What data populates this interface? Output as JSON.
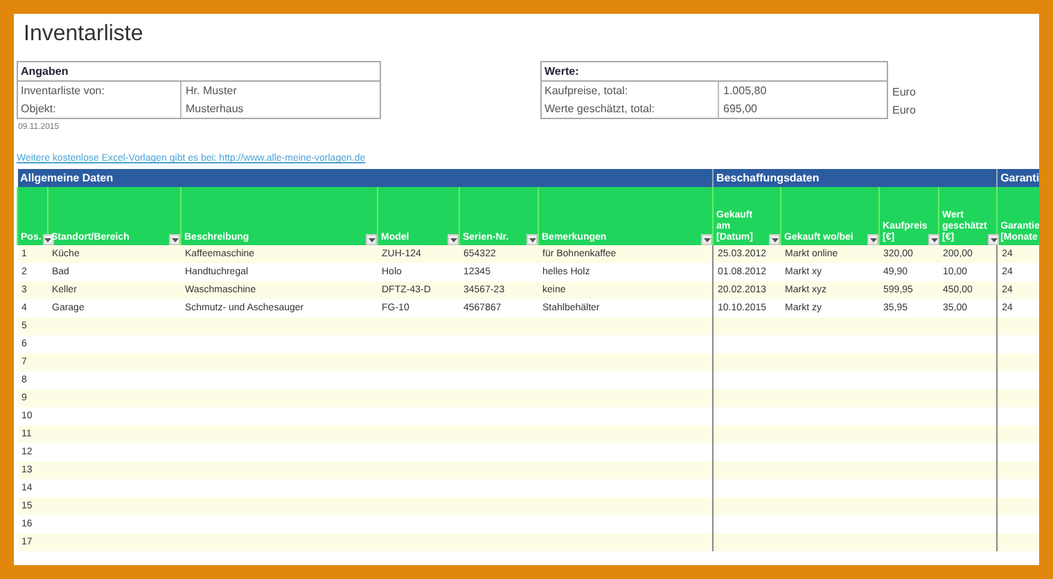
{
  "title": "Inventarliste",
  "angaben": {
    "heading": "Angaben",
    "rows": [
      {
        "label": "Inventarliste von:",
        "value": "Hr. Muster"
      },
      {
        "label": "Objekt:",
        "value": "Musterhaus"
      }
    ]
  },
  "date": "09.11.2015",
  "werte": {
    "heading": "Werte:",
    "rows": [
      {
        "label": "Kaufpreise, total:",
        "value": "1.005,80",
        "unit": "Euro"
      },
      {
        "label": "Werte geschätzt, total:",
        "value": "695,00",
        "unit": "Euro"
      }
    ]
  },
  "link": "Weitere kostenlose Excel-Vorlagen gibt es bei: http://www.alle-meine-vorlagen.de",
  "table": {
    "groups": [
      {
        "label": "Allgemeine Daten",
        "columns": [
          "Pos.",
          "Standort/Bereich",
          "Beschreibung",
          "Model",
          "Serien-Nr.",
          "Bemerkungen"
        ]
      },
      {
        "label": "Beschaffungsdaten",
        "columns": [
          "Gekauft am [Datum]",
          "Gekauft wo/bei",
          "Kaufpreis [€]",
          "Wert geschätzt [€]"
        ]
      },
      {
        "label": "Garanti",
        "columns": [
          "Garantie [Monate"
        ]
      }
    ],
    "rows": [
      [
        "1",
        "Küche",
        "Kaffeemaschine",
        "ZUH-124",
        "654322",
        "für Bohnenkaffee",
        "25.03.2012",
        "Markt online",
        "320,00",
        "200,00",
        "24"
      ],
      [
        "2",
        "Bad",
        "Handtuchregal",
        "Holo",
        "12345",
        "helles Holz",
        "01.08.2012",
        "Markt xy",
        "49,90",
        "10,00",
        "24"
      ],
      [
        "3",
        "Keller",
        "Waschmaschine",
        "DFTZ-43-D",
        "34567-23",
        "keine",
        "20.02.2013",
        "Markt xyz",
        "599,95",
        "450,00",
        "24"
      ],
      [
        "4",
        "Garage",
        "Schmutz- und Aschesauger",
        "FG-10",
        "4567867",
        "Stahlbehälter",
        "10.10.2015",
        "Markt zy",
        "35,95",
        "35,00",
        "24"
      ],
      [
        "5"
      ],
      [
        "6"
      ],
      [
        "7"
      ],
      [
        "8"
      ],
      [
        "9"
      ],
      [
        "10"
      ],
      [
        "11"
      ],
      [
        "12"
      ],
      [
        "13"
      ],
      [
        "14"
      ],
      [
        "15"
      ],
      [
        "16"
      ],
      [
        "17"
      ]
    ]
  }
}
